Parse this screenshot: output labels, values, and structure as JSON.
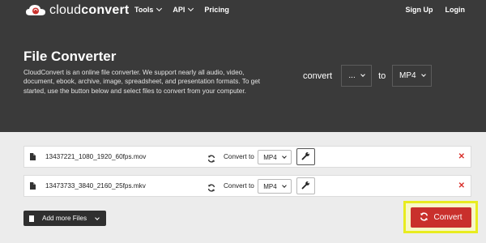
{
  "brand": {
    "name_light": "cloud",
    "name_bold": "convert"
  },
  "nav": {
    "items": [
      {
        "label": "Tools",
        "has_caret": true
      },
      {
        "label": "API",
        "has_caret": true
      },
      {
        "label": "Pricing",
        "has_caret": false
      }
    ]
  },
  "auth": {
    "signup": "Sign Up",
    "login": "Login"
  },
  "hero": {
    "title": "File Converter",
    "description": "CloudConvert is an online file converter. We support nearly all audio, video, document, ebook, archive, image, spreadsheet, and presentation formats. To get started, use the button below and select files to convert from your computer."
  },
  "converter": {
    "label_convert": "convert",
    "from_value": "...",
    "label_to": "to",
    "to_value": "MP4"
  },
  "files": [
    {
      "name": "13437221_1080_1920_60fps.mov",
      "convert_to_label": "Convert to",
      "format": "MP4"
    },
    {
      "name": "13473733_3840_2160_25fps.mkv",
      "convert_to_label": "Convert to",
      "format": "MP4"
    }
  ],
  "actions": {
    "add_files": "Add more Files",
    "convert": "Convert"
  },
  "colors": {
    "hero_bg": "#3a3a3a",
    "accent_red": "#c9302c",
    "highlight": "#e8ec1f",
    "remove": "#d9302c"
  }
}
